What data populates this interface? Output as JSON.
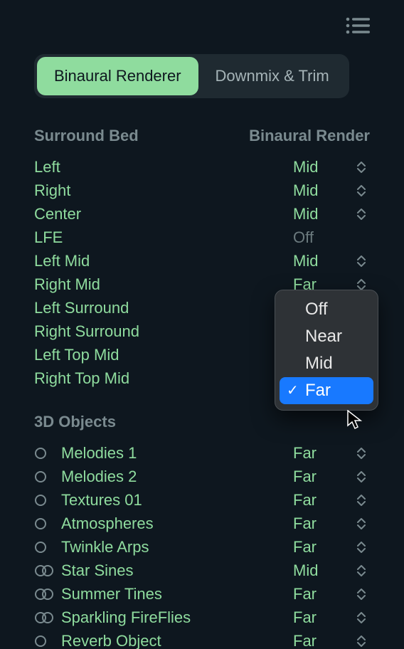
{
  "tabs": {
    "tab1": "Binaural Renderer",
    "tab2": "Downmix & Trim"
  },
  "headers": {
    "col1": "Surround Bed",
    "col2": "Binaural Render",
    "objects": "3D Objects"
  },
  "bed": [
    {
      "name": "Left",
      "value": "Mid",
      "stepper": true
    },
    {
      "name": "Right",
      "value": "Mid",
      "stepper": true
    },
    {
      "name": "Center",
      "value": "Mid",
      "stepper": true
    },
    {
      "name": "LFE",
      "value": "Off",
      "stepper": false,
      "disabled": true
    },
    {
      "name": "Left Mid",
      "value": "Mid",
      "stepper": true
    },
    {
      "name": "Right Mid",
      "value": "Far",
      "stepper": true
    },
    {
      "name": "Left Surround",
      "value": "",
      "stepper": false
    },
    {
      "name": "Right Surround",
      "value": "",
      "stepper": false
    },
    {
      "name": "Left Top Mid",
      "value": "",
      "stepper": false
    },
    {
      "name": "Right Top Mid",
      "value": "",
      "stepper": false
    }
  ],
  "objects": [
    {
      "name": "Melodies 1",
      "value": "Far",
      "stereo": "mono"
    },
    {
      "name": "Melodies 2",
      "value": "Far",
      "stereo": "mono"
    },
    {
      "name": "Textures 01",
      "value": "Far",
      "stereo": "mono"
    },
    {
      "name": "Atmospheres",
      "value": "Far",
      "stereo": "mono"
    },
    {
      "name": "Twinkle Arps",
      "value": "Far",
      "stereo": "mono"
    },
    {
      "name": "Star Sines",
      "value": "Mid",
      "stereo": "stereo"
    },
    {
      "name": "Summer Tines",
      "value": "Far",
      "stereo": "stereo"
    },
    {
      "name": "Sparkling FireFlies",
      "value": "Far",
      "stereo": "stereo"
    },
    {
      "name": "Reverb Object",
      "value": "Far",
      "stereo": "mono"
    }
  ],
  "dropdown": {
    "options": [
      "Off",
      "Near",
      "Mid",
      "Far"
    ],
    "selected": "Far"
  }
}
